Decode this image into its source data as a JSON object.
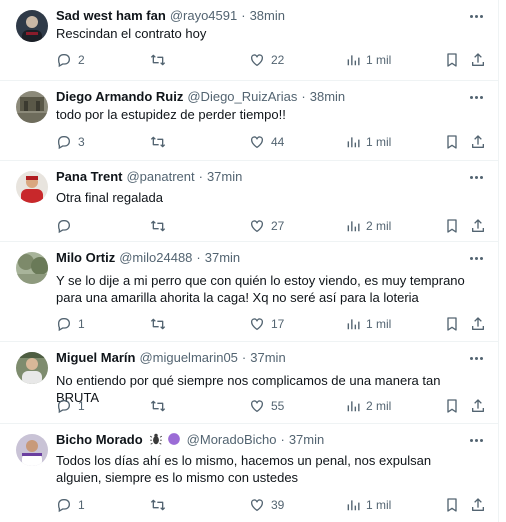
{
  "tweets": [
    {
      "name": "Sad west ham fan",
      "handle": "@rayo4591",
      "time": "38min",
      "text": "Rescindan el contrato hoy",
      "replies": "2",
      "retweets": "",
      "likes": "22",
      "views": "1 mil",
      "avatar_color": "#2f3a48"
    },
    {
      "name": "Diego Armando Ruiz",
      "handle": "@Diego_RuizArias",
      "time": "38min",
      "text": "todo por la estupidez de perder tiempo!!",
      "replies": "3",
      "retweets": "",
      "likes": "44",
      "views": "1 mil",
      "avatar_color": "#6b6a5f"
    },
    {
      "name": "Pana Trent",
      "handle": "@panatrent",
      "time": "37min",
      "text": "Otra final regalada",
      "replies": "",
      "retweets": "",
      "likes": "27",
      "views": "2 mil",
      "avatar_color": "#c8282b"
    },
    {
      "name": "Milo Ortiz",
      "handle": "@milo24488",
      "time": "37min",
      "text": "Y se lo dije a mi perro que con quién lo estoy viendo, es muy temprano para una amarilla ahorita la caga! Xq no seré así para la loteria",
      "replies": "1",
      "retweets": "",
      "likes": "17",
      "views": "1 mil",
      "avatar_color": "#7d8a6a"
    },
    {
      "name": "Miguel Marín",
      "handle": "@miguelmarin05",
      "time": "37min",
      "text": "No entiendo por qué siempre nos complicamos de una manera tan BRUTA",
      "replies": "1",
      "retweets": "",
      "likes": "55",
      "views": "2 mil",
      "avatar_color": "#5a6b4e"
    },
    {
      "name": "Bicho Morado",
      "handle": "@MoradoBicho",
      "time": "37min",
      "text": "Todos los días ahí es lo mismo, hacemos un penal, nos expulsan alguien, siempre es lo mismo con ustedes",
      "replies": "1",
      "retweets": "",
      "likes": "39",
      "views": "1 mil",
      "avatar_color": "#6b3fa0"
    }
  ],
  "colors": {
    "text": "#0f1419",
    "muted": "#536471",
    "border": "#eff3f4",
    "purple": "#9b6cd6"
  },
  "icons": [
    "more-icon",
    "reply-icon",
    "retweet-icon",
    "like-icon",
    "views-icon",
    "bookmark-icon",
    "share-icon",
    "bug-emoji-icon",
    "purple-circle-icon"
  ]
}
